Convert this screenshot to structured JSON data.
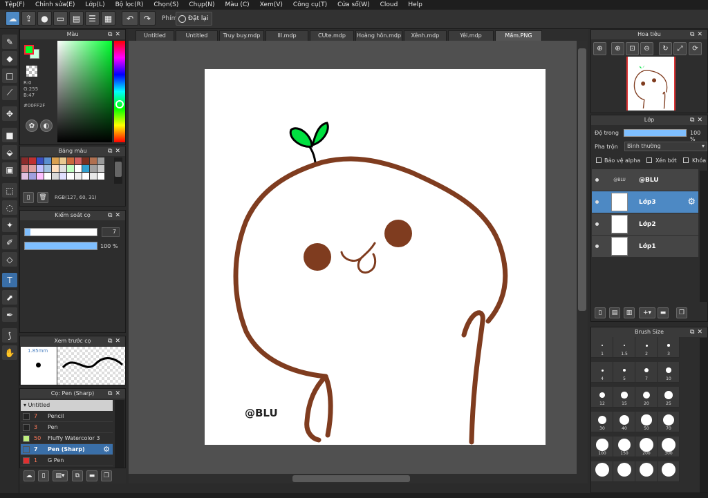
{
  "menu": [
    "Tệp(F)",
    "Chỉnh sửa(E)",
    "Lớp(L)",
    "Bộ lọc(R)",
    "Chọn(S)",
    "Chụp(N)",
    "Màu (C)",
    "Xem(V)",
    "Công cụ(T)",
    "Cửa sổ(W)",
    "Cloud",
    "Help"
  ],
  "toolbar": {
    "shortcut_label": "Phím",
    "reset_label": "Đặt lại"
  },
  "color_panel": {
    "title": "Màu",
    "r": "R:0",
    "g": "G:255",
    "b": "B:47",
    "hex": "#00FF2F",
    "primary": "#00ff2f",
    "secondary": "#c8ffe0"
  },
  "palette_panel": {
    "title": "Bảng màu",
    "rgb_readout": "RGB(127, 60, 31)",
    "colors": [
      "#8b2b2b",
      "#c03030",
      "#3a4fc0",
      "#5a8fd0",
      "#d9a050",
      "#e8c890",
      "#c86a3c",
      "#d06060",
      "#7a3020",
      "#b07050",
      "#9a9a9a",
      "#d07f7f",
      "#e0a0a0",
      "#c0c0ff",
      "#a0c0e0",
      "#ffe0c0",
      "#e0e0e0",
      "#c0ffc0",
      "#ffffff",
      "#30a0d0",
      "#a0a0a0",
      "#c8c8c8",
      "#e0c0e0",
      "#a0a0e0",
      "#ffc0ff",
      "#ffffff",
      "#d8d8d8",
      "#e0e0ff",
      "#ffffff",
      "#f0f0f0",
      "#ffffff",
      "#e8e8e8",
      "#ffffff"
    ]
  },
  "brush_control": {
    "title": "Kiểm soát cọ",
    "size_value": "7",
    "opacity_value": "100 %",
    "size_fraction": 0.08,
    "opacity_fraction": 1.0
  },
  "brush_preview": {
    "title": "Xem trước cọ",
    "size_label": "1.85mm"
  },
  "brush_list": {
    "title": "Cọ: Pen (Sharp)",
    "group": "Untitled",
    "items": [
      {
        "size": "7",
        "name": "Pencil",
        "color": "#222222"
      },
      {
        "size": "3",
        "name": "Pen",
        "color": "#222222"
      },
      {
        "size": "50",
        "name": "Fluffy Watercolor 3",
        "color": "#c0f080"
      },
      {
        "size": "7",
        "name": "Pen (Sharp)",
        "color": "#3a6fa8"
      },
      {
        "size": "1",
        "name": "G Pen",
        "color": "#e03030"
      }
    ]
  },
  "tabs": [
    "Untitled",
    "Untitled",
    "Truy buy.mdp",
    "lll.mdp",
    "CUte.mdp",
    "Hoàng hôn.mdp",
    "Xênh.mdp",
    "Yêi.mdp",
    "Mầm.PNG"
  ],
  "canvas": {
    "watermark": "@BLU",
    "line_color": "#7f3c1f",
    "sprout_color": "#00e040"
  },
  "navigator": {
    "title": "Hoa tiêu"
  },
  "layers_panel": {
    "title": "Lớp",
    "opacity_label": "Độ trong",
    "opacity_value": "100 %",
    "blend_label": "Pha trộn",
    "blend_value": "Bình thường",
    "protect_alpha": "Bảo vệ alpha",
    "clipping": "Xén bớt",
    "lock": "Khóa",
    "layers": [
      {
        "name": "@BLU",
        "thumb_text": "@BLU"
      },
      {
        "name": "Lớp3"
      },
      {
        "name": "Lớp2"
      },
      {
        "name": "Lớp1"
      }
    ]
  },
  "brush_size_panel": {
    "title": "Brush Size",
    "sizes": [
      "1",
      "1.5",
      "2",
      "3",
      "4",
      "5",
      "7",
      "10",
      "12",
      "15",
      "20",
      "25",
      "30",
      "40",
      "50",
      "70",
      "100",
      "150",
      "200",
      "300",
      "",
      "",
      "",
      ""
    ]
  }
}
